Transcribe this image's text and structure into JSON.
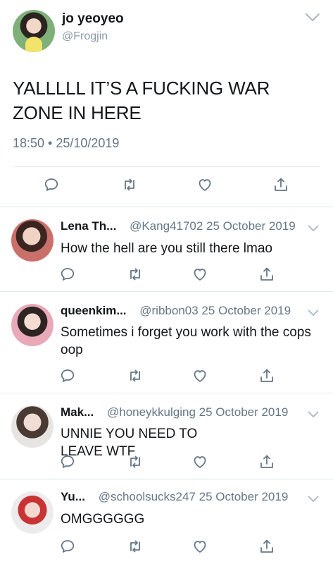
{
  "main_tweet": {
    "display_name": "jo yeoyeo",
    "handle": "@Frogjin",
    "text": "YALLLLL IT’S A FUCKING WAR ZONE IN HERE",
    "timestamp": "18:50 • 25/10/2019",
    "icons": [
      "reply-icon",
      "retweet-icon",
      "like-icon",
      "share-icon"
    ]
  },
  "replies": [
    {
      "name": "Lena Th...",
      "meta": "@Kang41702 25 October 2019",
      "text": "How the hell are you still there lmao"
    },
    {
      "name": "queenkim...",
      "meta": "@ribbon03 25 October 2019",
      "text": "Sometimes i forget you work with the cops oop"
    },
    {
      "name": "Mak...",
      "meta": "@honeykkulging 25 October 2019",
      "text": "UNNIE YOU NEED TO LEAVE WTF"
    },
    {
      "name": "Yu...",
      "meta": "@schoolsucks247 25 October 2019",
      "text": "OMGGGGGG"
    }
  ],
  "colors": {
    "text": "#14171a",
    "secondary": "#657786",
    "icon": "#657786",
    "divider": "#e1e8ed"
  }
}
